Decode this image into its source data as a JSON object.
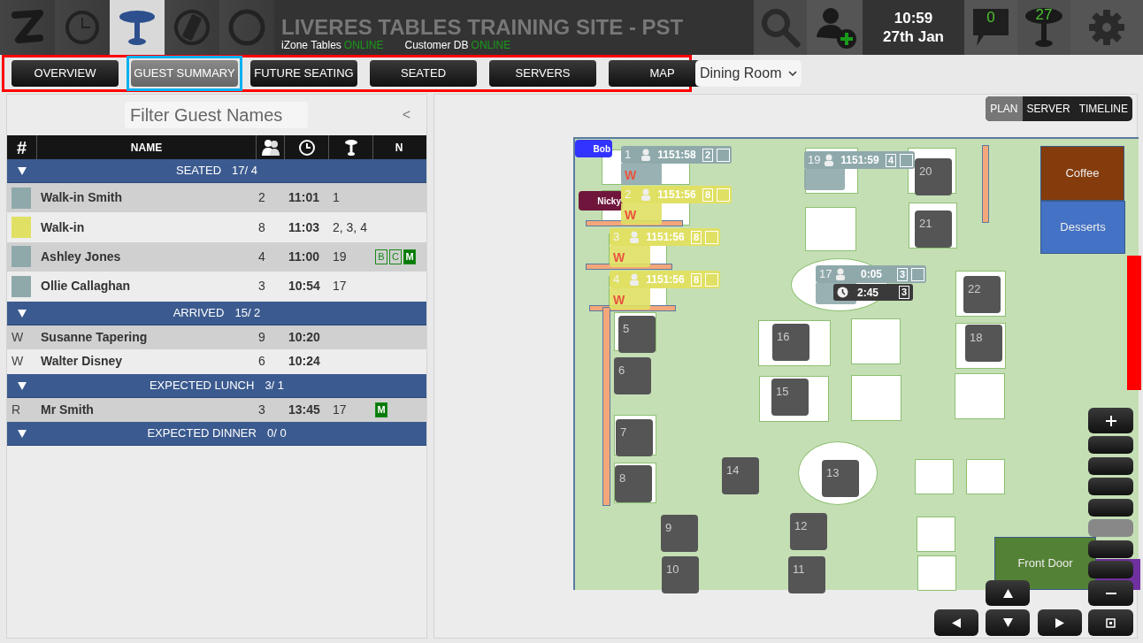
{
  "app": {
    "title": "LIVERES TABLES TRAINING SITE - PST",
    "statuses": [
      {
        "label": "iZone Tables",
        "state": "ONLINE"
      },
      {
        "label": "Customer DB",
        "state": "ONLINE"
      }
    ]
  },
  "launcher": [
    {
      "kind": "logo",
      "selected": false
    },
    {
      "kind": "clock",
      "selected": false
    },
    {
      "kind": "table",
      "selected": true
    },
    {
      "kind": "dish",
      "selected": false
    },
    {
      "kind": "ring",
      "selected": false
    }
  ],
  "toolbar": {
    "time": "10:59",
    "date": "27th Jan",
    "messages": "0",
    "tables": "27"
  },
  "nav": {
    "framed": true,
    "tabs": [
      {
        "label": "OVERVIEW",
        "selected": false,
        "highlighted": false
      },
      {
        "label": "GUEST SUMMARY",
        "selected": true,
        "highlighted": true
      },
      {
        "label": "FUTURE SEATING",
        "selected": false,
        "highlighted": false
      },
      {
        "label": "SEATED",
        "selected": false,
        "highlighted": false
      },
      {
        "label": "SERVERS",
        "selected": false,
        "highlighted": false
      },
      {
        "label": "MAP",
        "selected": false,
        "highlighted": false
      }
    ]
  },
  "room_select": {
    "value": "Dining Room"
  },
  "guests": {
    "filter_placeholder": "Filter Guest Names",
    "collapse": "<",
    "columns": [
      {
        "kind": "text",
        "label": "#"
      },
      {
        "kind": "text",
        "label": "NAME"
      },
      {
        "kind": "guests"
      },
      {
        "kind": "time"
      },
      {
        "kind": "table"
      },
      {
        "kind": "text",
        "label": "N"
      }
    ],
    "groups": [
      {
        "label": "SEATED",
        "counts": "17/ 4",
        "expanded": true,
        "rows": [
          {
            "marker": {
              "kind": "swatch",
              "color": "#8fa9ab"
            },
            "name": "Walk-in Smith",
            "guests": "2",
            "time": "11:01",
            "tables": "1"
          },
          {
            "marker": {
              "kind": "swatch",
              "color": "#e0e064"
            },
            "name": "Walk-in",
            "guests": "8",
            "time": "11:03",
            "tables": "2, 3, 4"
          },
          {
            "marker": {
              "kind": "swatch",
              "color": "#8fa9ab"
            },
            "name": "Ashley Jones",
            "guests": "4",
            "time": "11:00",
            "tables": "19",
            "notes": [
              {
                "label": "B",
                "filled": false
              },
              {
                "label": "C",
                "filled": false
              },
              {
                "label": "M",
                "filled": true
              }
            ]
          },
          {
            "marker": {
              "kind": "swatch",
              "color": "#8fa9ab"
            },
            "name": "Ollie Callaghan",
            "guests": "3",
            "time": "10:54",
            "tables": "17"
          }
        ]
      },
      {
        "label": "ARRIVED",
        "counts": "15/ 2",
        "expanded": true,
        "rows": [
          {
            "marker": {
              "kind": "letter",
              "text": "W"
            },
            "name": "Susanne Tapering",
            "guests": "9",
            "time": "10:20"
          },
          {
            "marker": {
              "kind": "letter",
              "text": "W"
            },
            "name": "Walter Disney",
            "guests": "6",
            "time": "10:24"
          }
        ]
      },
      {
        "label": "EXPECTED LUNCH",
        "counts": "3/ 1",
        "expanded": true,
        "rows": [
          {
            "marker": {
              "kind": "letter",
              "text": "R"
            },
            "name": "Mr Smith",
            "guests": "3",
            "time": "13:45",
            "tables": "17",
            "notes": [
              {
                "label": "M",
                "filled": true
              }
            ]
          }
        ]
      },
      {
        "label": "EXPECTED DINNER",
        "counts": "0/ 0",
        "expanded": true
      }
    ]
  },
  "map": {
    "view_modes": [
      {
        "label": "PLAN",
        "selected": true
      },
      {
        "label": "SERVER",
        "selected": false
      },
      {
        "label": "TIMELINE",
        "selected": false
      }
    ],
    "tables": [
      {
        "label": "20"
      },
      {
        "label": "21"
      },
      {
        "label": "22"
      },
      {
        "label": "5"
      },
      {
        "label": "6"
      },
      {
        "label": "7"
      },
      {
        "label": "8"
      },
      {
        "label": "16"
      },
      {
        "label": "18"
      },
      {
        "label": "15"
      },
      {
        "label": "14"
      },
      {
        "label": "13"
      },
      {
        "label": "9"
      },
      {
        "label": "12"
      },
      {
        "label": "10"
      },
      {
        "label": "11"
      }
    ],
    "seated": [
      {
        "table": "1",
        "timer": "1151:58",
        "covers": "2",
        "flag": "W",
        "color": "#8fa9ab"
      },
      {
        "table": "2",
        "timer": "1151:56",
        "covers": "8",
        "flag": "W",
        "color": "#e0e064"
      },
      {
        "table": "3",
        "timer": "1151:56",
        "covers": "8",
        "flag": "W",
        "color": "#e0e064"
      },
      {
        "table": "4",
        "timer": "1151:56",
        "covers": "8",
        "flag": "W",
        "color": "#e0e064"
      },
      {
        "table": "19",
        "timer": "1151:59",
        "covers": "4",
        "color": "#8fa9ab"
      },
      {
        "table": "17",
        "timer": "0:05",
        "covers": "3",
        "color": "#8fa9ab",
        "booking": {
          "time": "2:45",
          "covers": "3"
        }
      }
    ],
    "areas": [
      {
        "label": "Coffee",
        "color": "#843c0c"
      },
      {
        "label": "Desserts",
        "color": "#4472c4"
      },
      {
        "label": "Front Door",
        "color": "#538135"
      }
    ],
    "staff": [
      {
        "label": "Bob",
        "color": "#3333ff"
      },
      {
        "label": "Nicky",
        "color": "#70163c"
      }
    ],
    "zoom": {
      "steps": [
        {
          "selected": false
        },
        {
          "selected": false
        },
        {
          "selected": false
        },
        {
          "selected": false
        },
        {
          "selected": true
        },
        {
          "selected": false
        },
        {
          "selected": false
        }
      ]
    }
  }
}
